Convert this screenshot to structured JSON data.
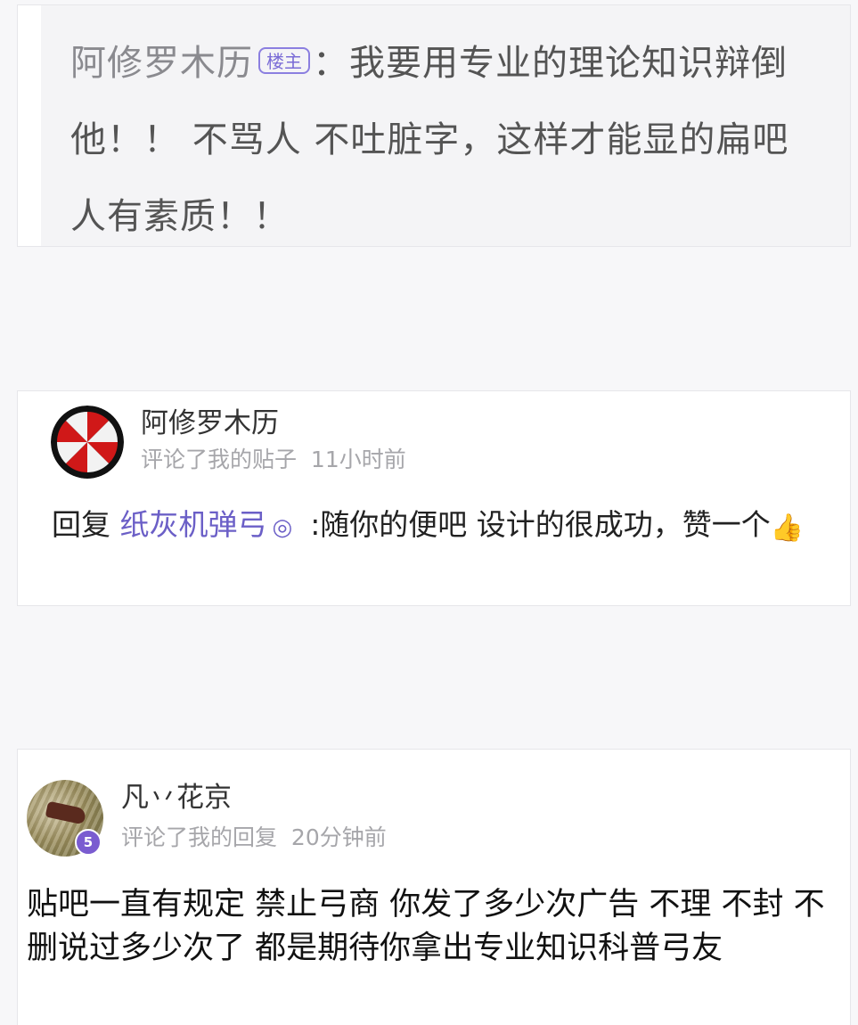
{
  "quoted_post": {
    "author": "阿修罗木历",
    "op_badge": "楼主",
    "separator": "：",
    "text": "我要用专业的理论知识辩倒他！！ 不骂人 不吐脏字，这样才能显的扁吧人有素质！！"
  },
  "notifications": [
    {
      "username": "阿修罗木历",
      "action": "评论了我的贴子",
      "time": "11小时前",
      "reply_prefix": "回复",
      "mention": "纸灰机弹弓",
      "mention_icon": "◎",
      "content": ":随你的便吧 设计的很成功，赞一个",
      "emoji": "👍"
    },
    {
      "username": "凡丷花京",
      "action": "评论了我的回复",
      "time": "20分钟前",
      "level": "5",
      "content": "贴吧一直有规定 禁止弓商 你发了多少次广告 不理 不封 不删说过多少次了 都是期待你拿出专业知识科普弓友"
    }
  ],
  "colors": {
    "accent": "#6b5fc7",
    "badge_border": "#8b7fe0",
    "meta_gray": "#a6a6aa",
    "level_purple": "#7a5cd0"
  },
  "icons": {
    "avatar1": "umbrella-logo-icon",
    "avatar2": "photo-avatar",
    "level": "level-badge-icon",
    "mention_suffix": "circle-icon",
    "emoji": "thumbs-up-icon"
  }
}
